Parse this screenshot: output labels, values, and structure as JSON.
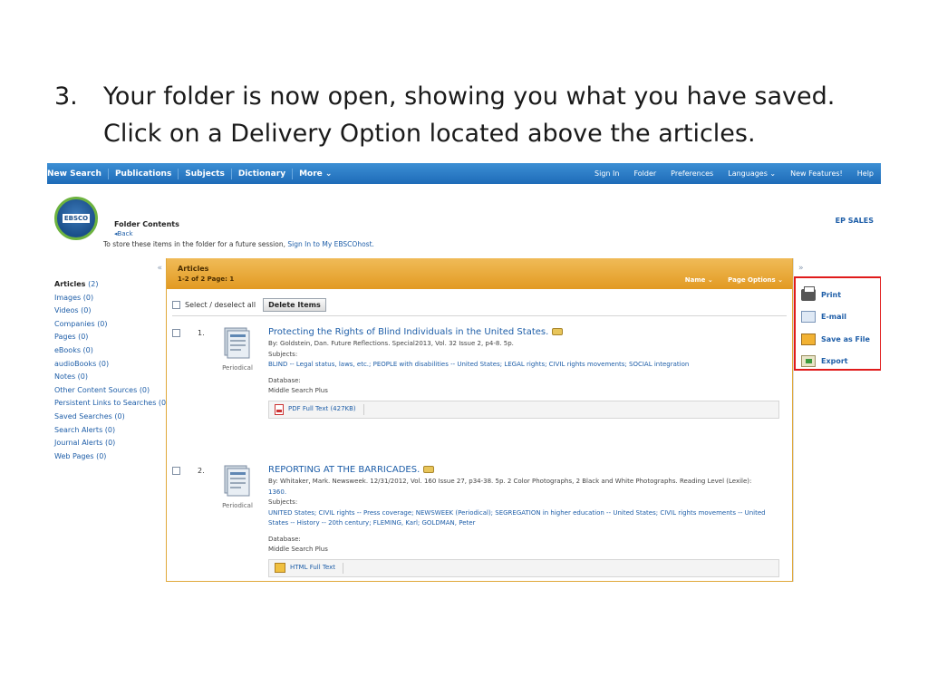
{
  "slide": {
    "step_number": "3.",
    "line1": "Your folder is now open, showing you what you have saved.",
    "line2": "Click on a Delivery Option located above the articles."
  },
  "topnav": {
    "left": [
      "New Search",
      "Publications",
      "Subjects",
      "Dictionary",
      "More ⌄"
    ],
    "right": [
      "Sign In",
      "Folder",
      "Preferences",
      "Languages ⌄",
      "New Features!",
      "Help"
    ]
  },
  "header": {
    "logo_text": "EBSCO",
    "folder_title": "Folder Contents",
    "back": "◂Back",
    "store_text": "To store these items in the folder for a future session,",
    "store_link": "Sign In to My EBSCOhost.",
    "account": "EP SALES"
  },
  "left": {
    "collapse": "«",
    "items": [
      {
        "label": "Articles",
        "count": "(2)"
      },
      {
        "label": "Images",
        "count": "(0)"
      },
      {
        "label": "Videos",
        "count": "(0)"
      },
      {
        "label": "Companies",
        "count": "(0)"
      },
      {
        "label": "Pages",
        "count": "(0)"
      },
      {
        "label": "eBooks",
        "count": "(0)"
      },
      {
        "label": "audioBooks",
        "count": "(0)"
      },
      {
        "label": "Notes",
        "count": "(0)"
      },
      {
        "label": "Other Content Sources",
        "count": "(0)"
      },
      {
        "label": "Persistent Links to Searches",
        "count": "(0)"
      },
      {
        "label": "Saved Searches",
        "count": "(0)"
      },
      {
        "label": "Search Alerts",
        "count": "(0)"
      },
      {
        "label": "Journal Alerts",
        "count": "(0)"
      },
      {
        "label": "Web Pages",
        "count": "(0)"
      }
    ]
  },
  "main": {
    "heading": "Articles",
    "range": "1-2 of 2  Page: 1",
    "name_sort": "Name ⌄",
    "page_options": "Page Options ⌄",
    "select_all": "Select / deselect all",
    "delete_items": "Delete Items",
    "results": [
      {
        "num": "1.",
        "type": "Periodical",
        "title": "Protecting the Rights of Blind Individuals in the United States.",
        "byline": "By: Goldstein, Dan. Future Reflections. Special2013, Vol. 32 Issue 2, p4-8. 5p.",
        "byline_link": "",
        "subjects_label": "Subjects:",
        "subjects": "BLIND -- Legal status, laws, etc.; PEOPLE with disabilities -- United States; LEGAL rights; CIVIL rights movements; SOCIAL integration",
        "database_label": "Database:",
        "database": "Middle Search Plus",
        "fulltext": "PDF Full Text (427KB)"
      },
      {
        "num": "2.",
        "type": "Periodical",
        "title": "REPORTING AT THE BARRICADES.",
        "byline": "By: Whitaker, Mark. Newsweek. 12/31/2012, Vol. 160 Issue 27, p34-38. 5p. 2 Color Photographs, 2 Black and White Photographs. Reading Level (Lexile):",
        "byline_link": "1360.",
        "subjects_label": "Subjects:",
        "subjects": "UNITED States; CIVIL rights -- Press coverage; NEWSWEEK (Periodical); SEGREGATION in higher education -- United States; CIVIL rights movements -- United States -- History -- 20th century; FLEMING, Karl; GOLDMAN, Peter",
        "database_label": "Database:",
        "database": "Middle Search Plus",
        "fulltext": "HTML Full Text"
      }
    ]
  },
  "right": {
    "collapse": "»",
    "options": [
      "Print",
      "E-mail",
      "Save as File",
      "Export"
    ]
  }
}
